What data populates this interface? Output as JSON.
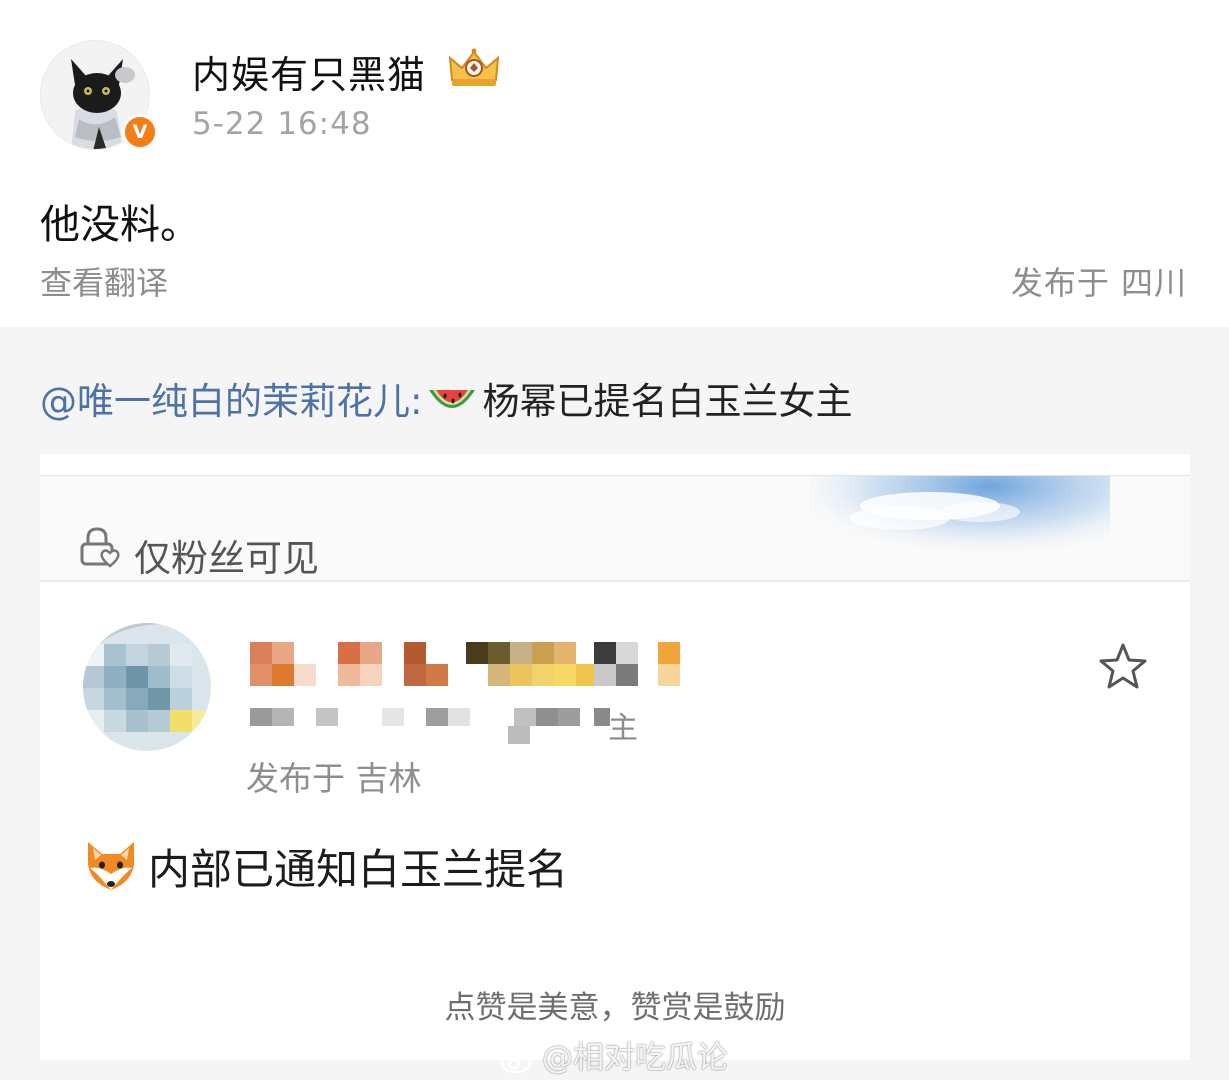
{
  "post": {
    "author": "内娱有只黑猫",
    "time": "5-22 16:48",
    "text": "他没料。",
    "translate_link": "查看翻译",
    "location": "发布于 四川",
    "verified_badge": "V",
    "icons": [
      "avatar-black-cat",
      "verified-badge-icon",
      "crown-icon"
    ]
  },
  "repost": {
    "mention": "@唯一纯白的茉莉花儿",
    "separator": ":",
    "text": "杨幂已提名白玉兰女主",
    "emoji": "watermelon-emoji"
  },
  "screenshot": {
    "visibility_label": "仅粉丝可见",
    "blurred_name_tail": "主",
    "location": "发布于 吉林",
    "text": "内部已通知白玉兰提名",
    "emoji": "fox-emoji",
    "footer_text": "点赞是美意，赞赏是鼓励",
    "icons": [
      "lock-heart-icon",
      "star-icon",
      "blurred-avatar"
    ]
  },
  "watermark": {
    "text": "@相对吃瓜论",
    "icon": "weibo-icon"
  },
  "colors": {
    "mention_blue": "#4d72a7",
    "badge_orange": "#f57d18",
    "grey_text": "#8d8d8d",
    "repost_bg": "#f5f5f5"
  }
}
